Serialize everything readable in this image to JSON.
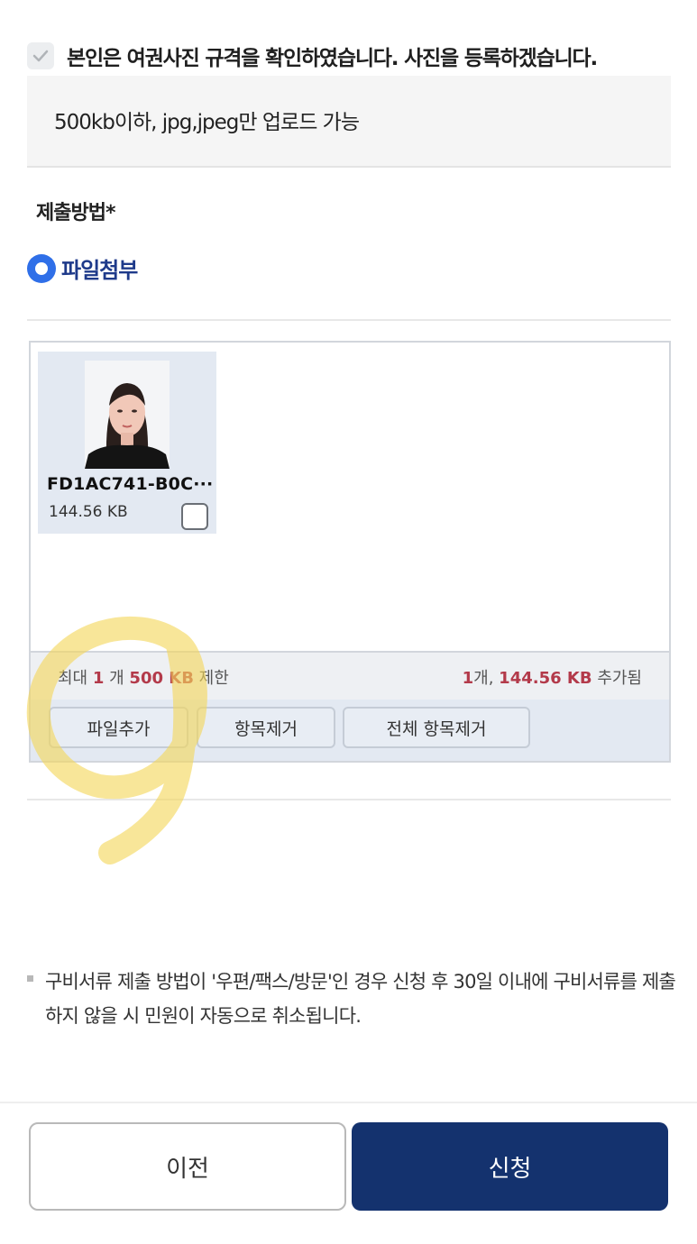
{
  "consent": {
    "text": "본인은 여권사진 규격을 확인하였습니다. 사진을 등록하겠습니다."
  },
  "notice": {
    "text": "500kb이하, jpg,jpeg만 업로드 가능"
  },
  "submission": {
    "label": "제출방법*",
    "option": "파일첨부"
  },
  "upload": {
    "file": {
      "name": "FD1AC741-B0C···",
      "size": "144.56 KB"
    },
    "limit": {
      "prefix": "최대",
      "count": "1",
      "unit": "개",
      "size": "500 KB",
      "suffix": "제한"
    },
    "added": {
      "count": "1",
      "unit": "개,",
      "size": "144.56 KB",
      "suffix": "추가됨"
    },
    "buttons": {
      "add": "파일추가",
      "remove": "항목제거",
      "remove_all": "전체 항목제거"
    }
  },
  "note": {
    "text": "구비서류 제출 방법이 '우편/팩스/방문'인 경우 신청 후 30일 이내에 구비서류를 제출하지 않을 시 민원이 자동으로 취소됩니다."
  },
  "footer": {
    "prev": "이전",
    "apply": "신청"
  },
  "colors": {
    "primary": "#14326e",
    "radio": "#2f6fe8",
    "highlight": "#b33a4a"
  }
}
